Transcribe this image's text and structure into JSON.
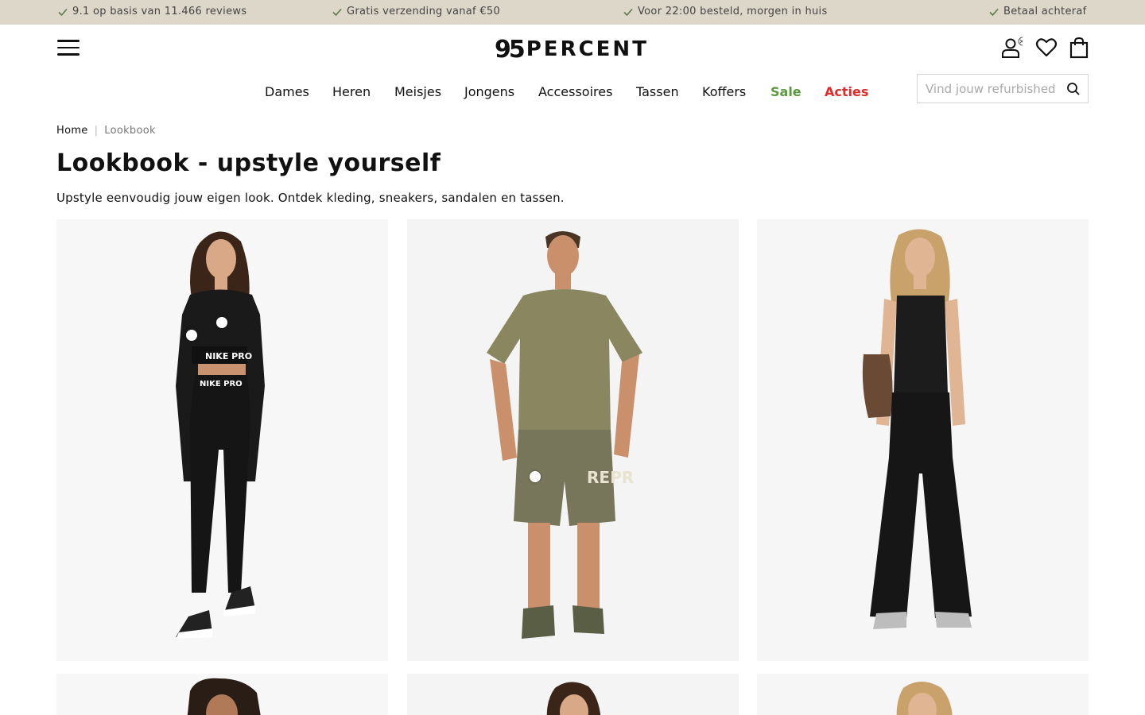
{
  "usp_bar": {
    "items": [
      "9.1 op basis van 11.466 reviews",
      "Gratis verzending vanaf €50",
      "Voor 22:00 besteld, morgen in huis",
      "Betaal achteraf"
    ]
  },
  "header": {
    "logo_mark": "95",
    "logo_word": "PERCENT",
    "icons": [
      "menu-icon",
      "account-icon",
      "wishlist-heart-icon",
      "shopping-bag-icon"
    ]
  },
  "nav": {
    "items": [
      "Dames",
      "Heren",
      "Meisjes",
      "Jongens",
      "Accessoires",
      "Tassen",
      "Koffers",
      "Sale",
      "Acties"
    ],
    "sale_color": "#5a9a3c",
    "acties_color": "#e02b2b"
  },
  "search": {
    "placeholder": "Vind jouw refurbished"
  },
  "breadcrumb": {
    "home": "Home",
    "separator": "|",
    "current": "Lookbook"
  },
  "page": {
    "title": "Lookbook - upstyle yourself",
    "intro": "Upstyle eenvoudig jouw eigen look. Ontdek kleding, sneakers, sandalen en tassen."
  },
  "colors": {
    "usp_background": "#dcd7c9",
    "card_background": "#f7f7f7"
  },
  "lookbook": {
    "cards": [
      {
        "logo_text": "NIKE PRO",
        "hotspot_count": 2
      },
      {
        "logo_text": "REPR",
        "hotspot_count": 1
      },
      {
        "logo_text": "",
        "hotspot_count": 0
      }
    ]
  }
}
